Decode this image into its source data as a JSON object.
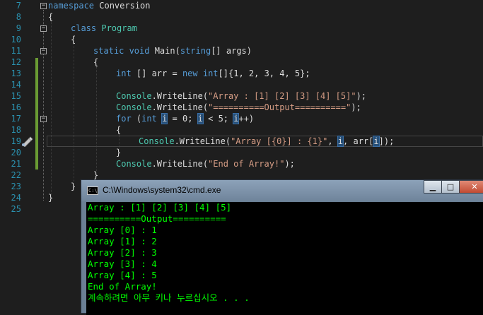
{
  "editor": {
    "line_numbers": [
      "7",
      "8",
      "9",
      "10",
      "11",
      "12",
      "13",
      "14",
      "15",
      "16",
      "17",
      "18",
      "19",
      "20",
      "21",
      "22",
      "23",
      "24",
      "25"
    ],
    "code": {
      "l7_kw": "namespace",
      "l7_name": " Conversion",
      "l8": "{",
      "l9_kw": "class",
      "l9_name": " Program",
      "l10": "{",
      "l11_kw1": "static",
      "l11_kw2": " void",
      "l11_rest1": " Main(",
      "l11_kw3": "string",
      "l11_rest2": "[] args)",
      "l12": "{",
      "l13_kw1": "int",
      "l13_rest1": " [] arr = ",
      "l13_kw2": "new",
      "l13_sp": " ",
      "l13_kw3": "int",
      "l13_rest2": "[]{1, 2, 3, 4, 5};",
      "l15_ty": "Console",
      "l15_rest1": ".WriteLine(",
      "l15_str": "\"Array : [1] [2] [3] [4] [5]\"",
      "l15_rest2": ");",
      "l16_ty": "Console",
      "l16_rest1": ".WriteLine(",
      "l16_str": "\"==========Output==========\"",
      "l16_rest2": ");",
      "l17_kw1": "for",
      "l17_rest1": " (",
      "l17_kw2": "int",
      "l17_sp": " ",
      "l17_i1": "i",
      "l17_rest2": " = 0; ",
      "l17_i2": "i",
      "l17_rest3": " < 5; ",
      "l17_i3": "i",
      "l17_rest4": "++)",
      "l18": "{",
      "l19_ty": "Console",
      "l19_rest1": ".WriteLine(",
      "l19_str": "\"Array [{0}] : {1}\"",
      "l19_rest2": ", ",
      "l19_i1": "i",
      "l19_rest3": ", arr[",
      "l19_i2": "i",
      "l19_rest4": "]);",
      "l20": "}",
      "l21_ty": "Console",
      "l21_rest1": ".WriteLine(",
      "l21_str": "\"End of Array!\"",
      "l21_rest2": ");",
      "l22": "}",
      "l23": "}",
      "l24": "}"
    },
    "fold_glyph": "−",
    "colors": {
      "keyword": "#569cd6",
      "type": "#4ec9b0",
      "string": "#d69d85",
      "line_number": "#2b91af",
      "change_bar": "#6a9b33"
    }
  },
  "cmd": {
    "title": "C:\\Windows\\system32\\cmd.exe",
    "icon_label": "C:\\",
    "buttons": {
      "minimize": "▁",
      "maximize": "□",
      "close": "✕"
    },
    "output": [
      "Array : [1] [2] [3] [4] [5]",
      "==========Output==========",
      "Array [0] : 1",
      "Array [1] : 2",
      "Array [2] : 3",
      "Array [3] : 4",
      "Array [4] : 5",
      "End of Array!",
      "계속하려면 아무 키나 누르십시오 . . ."
    ],
    "text_color": "#00ff00"
  }
}
